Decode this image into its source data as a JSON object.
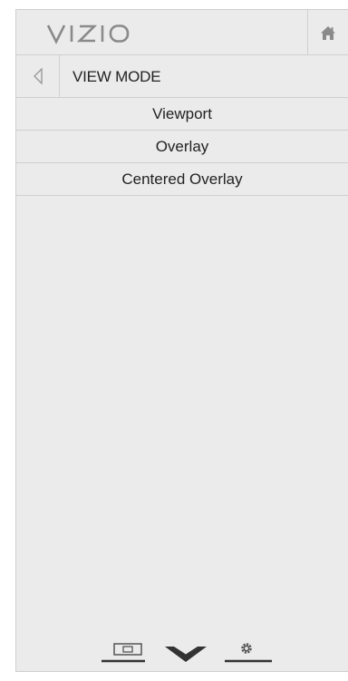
{
  "brand": {
    "logo_text": "VIZIO"
  },
  "header": {
    "home_icon": "home-icon"
  },
  "nav": {
    "back_icon": "back-arrow-icon",
    "title": "VIEW MODE"
  },
  "menu": {
    "items": [
      {
        "label": "Viewport"
      },
      {
        "label": "Overlay"
      },
      {
        "label": "Centered Overlay"
      }
    ]
  },
  "bottom_bar": {
    "items": [
      {
        "icon": "picture-mode-icon"
      },
      {
        "icon": "vizio-v-icon"
      },
      {
        "icon": "settings-gear-icon"
      }
    ]
  },
  "colors": {
    "panel_bg": "#ebebeb",
    "border": "#cfcfcf",
    "icon_gray": "#8a8a8a",
    "text": "#222222"
  }
}
